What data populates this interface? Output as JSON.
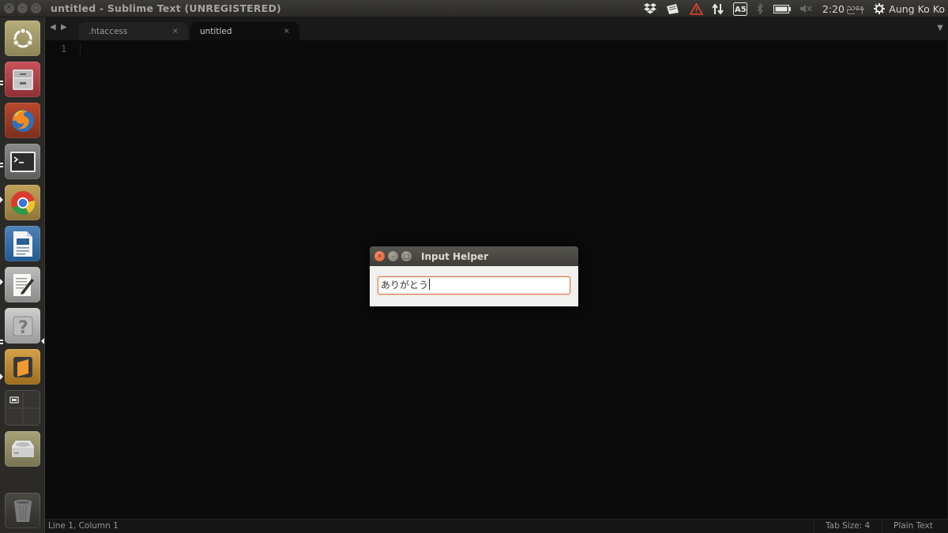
{
  "top_panel": {
    "window_title": "untitled - Sublime Text (UNREGISTERED)",
    "clock": "2:20",
    "clock_suffix": "ညနေ",
    "user_name": "Aung Ko Ko",
    "tray_icons": [
      "dropbox-icon",
      "wifi-folder-icon",
      "warning-icon",
      "network-icon",
      "input-method-icon",
      "bluetooth-icon",
      "battery-icon",
      "volume-muted-icon"
    ]
  },
  "launcher": {
    "items": [
      {
        "name": "dash-home",
        "icon": "ubuntu-logo-icon"
      },
      {
        "name": "files",
        "icon": "file-cabinet-icon"
      },
      {
        "name": "firefox",
        "icon": "firefox-icon"
      },
      {
        "name": "terminal",
        "icon": "terminal-icon"
      },
      {
        "name": "chrome",
        "icon": "chrome-icon"
      },
      {
        "name": "libreoffice-writer",
        "icon": "writer-icon"
      },
      {
        "name": "text-editor",
        "icon": "text-editor-icon"
      },
      {
        "name": "help",
        "icon": "help-icon"
      },
      {
        "name": "sublime-text",
        "icon": "sublime-icon"
      },
      {
        "name": "workspaces",
        "icon": "workspace-switcher-icon"
      },
      {
        "name": "drive",
        "icon": "hard-drive-icon"
      },
      {
        "name": "trash",
        "icon": "trash-icon"
      }
    ]
  },
  "editor": {
    "tabs": [
      {
        "label": ".htaccess",
        "close": "×"
      },
      {
        "label": "untitled",
        "close": "×"
      }
    ],
    "line_number": "1",
    "status": {
      "position": "Line 1, Column 1",
      "tab_size": "Tab Size: 4",
      "syntax": "Plain Text"
    }
  },
  "dialog": {
    "title": "Input Helper",
    "input_value": "ありがとう"
  },
  "colors": {
    "panel": "#3c3b37",
    "launcher": "#2b2a26",
    "editor_bg": "#0b0b0b",
    "dialog_close": "#e25a2e",
    "input_focus": "#e07a45"
  }
}
